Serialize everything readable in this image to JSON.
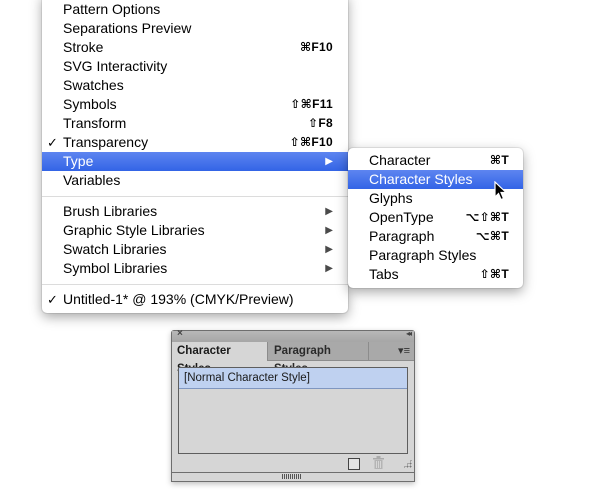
{
  "main_menu": {
    "items": [
      {
        "label": "Pattern Options",
        "shortcut": "",
        "checked": false,
        "submenu": false
      },
      {
        "label": "Separations Preview",
        "shortcut": "",
        "checked": false,
        "submenu": false
      },
      {
        "label": "Stroke",
        "shortcut": "⌘F10",
        "checked": false,
        "submenu": false
      },
      {
        "label": "SVG Interactivity",
        "shortcut": "",
        "checked": false,
        "submenu": false
      },
      {
        "label": "Swatches",
        "shortcut": "",
        "checked": false,
        "submenu": false
      },
      {
        "label": "Symbols",
        "shortcut": "⇧⌘F11",
        "checked": false,
        "submenu": false
      },
      {
        "label": "Transform",
        "shortcut": "⇧F8",
        "checked": false,
        "submenu": false
      },
      {
        "label": "Transparency",
        "shortcut": "⇧⌘F10",
        "checked": true,
        "submenu": false
      },
      {
        "label": "Type",
        "shortcut": "",
        "checked": false,
        "submenu": true,
        "highlighted": true
      },
      {
        "label": "Variables",
        "shortcut": "",
        "checked": false,
        "submenu": false
      }
    ],
    "libraries": [
      {
        "label": "Brush Libraries",
        "submenu": true
      },
      {
        "label": "Graphic Style Libraries",
        "submenu": true
      },
      {
        "label": "Swatch Libraries",
        "submenu": true
      },
      {
        "label": "Symbol Libraries",
        "submenu": true
      }
    ],
    "documents": [
      {
        "label": "Untitled-1* @ 193% (CMYK/Preview)",
        "checked": true
      }
    ],
    "check_glyph": "✓",
    "arrow_glyph": "▶"
  },
  "type_submenu": {
    "items": [
      {
        "label": "Character",
        "shortcut": "⌘T"
      },
      {
        "label": "Character Styles",
        "shortcut": "",
        "highlighted": true
      },
      {
        "label": "Glyphs",
        "shortcut": ""
      },
      {
        "label": "OpenType",
        "shortcut": "⌥⇧⌘T"
      },
      {
        "label": "Paragraph",
        "shortcut": "⌥⌘T"
      },
      {
        "label": "Paragraph Styles",
        "shortcut": ""
      },
      {
        "label": "Tabs",
        "shortcut": "⇧⌘T"
      }
    ]
  },
  "panel": {
    "close_glyph": "×",
    "collapse_glyph": "◂◂",
    "tabs": [
      {
        "label": "Character Styles",
        "active": true
      },
      {
        "label": "Paragraph Styles",
        "active": false
      }
    ],
    "menu_glyph": "▾≡",
    "list": [
      {
        "label": "[Normal Character Style]",
        "selected": true
      }
    ],
    "trash_glyph": "🗑"
  },
  "colors": {
    "menu_highlight": "#3d6de8",
    "selected_row": "#bfd1f0",
    "panel_bg": "#d6d6d6"
  }
}
